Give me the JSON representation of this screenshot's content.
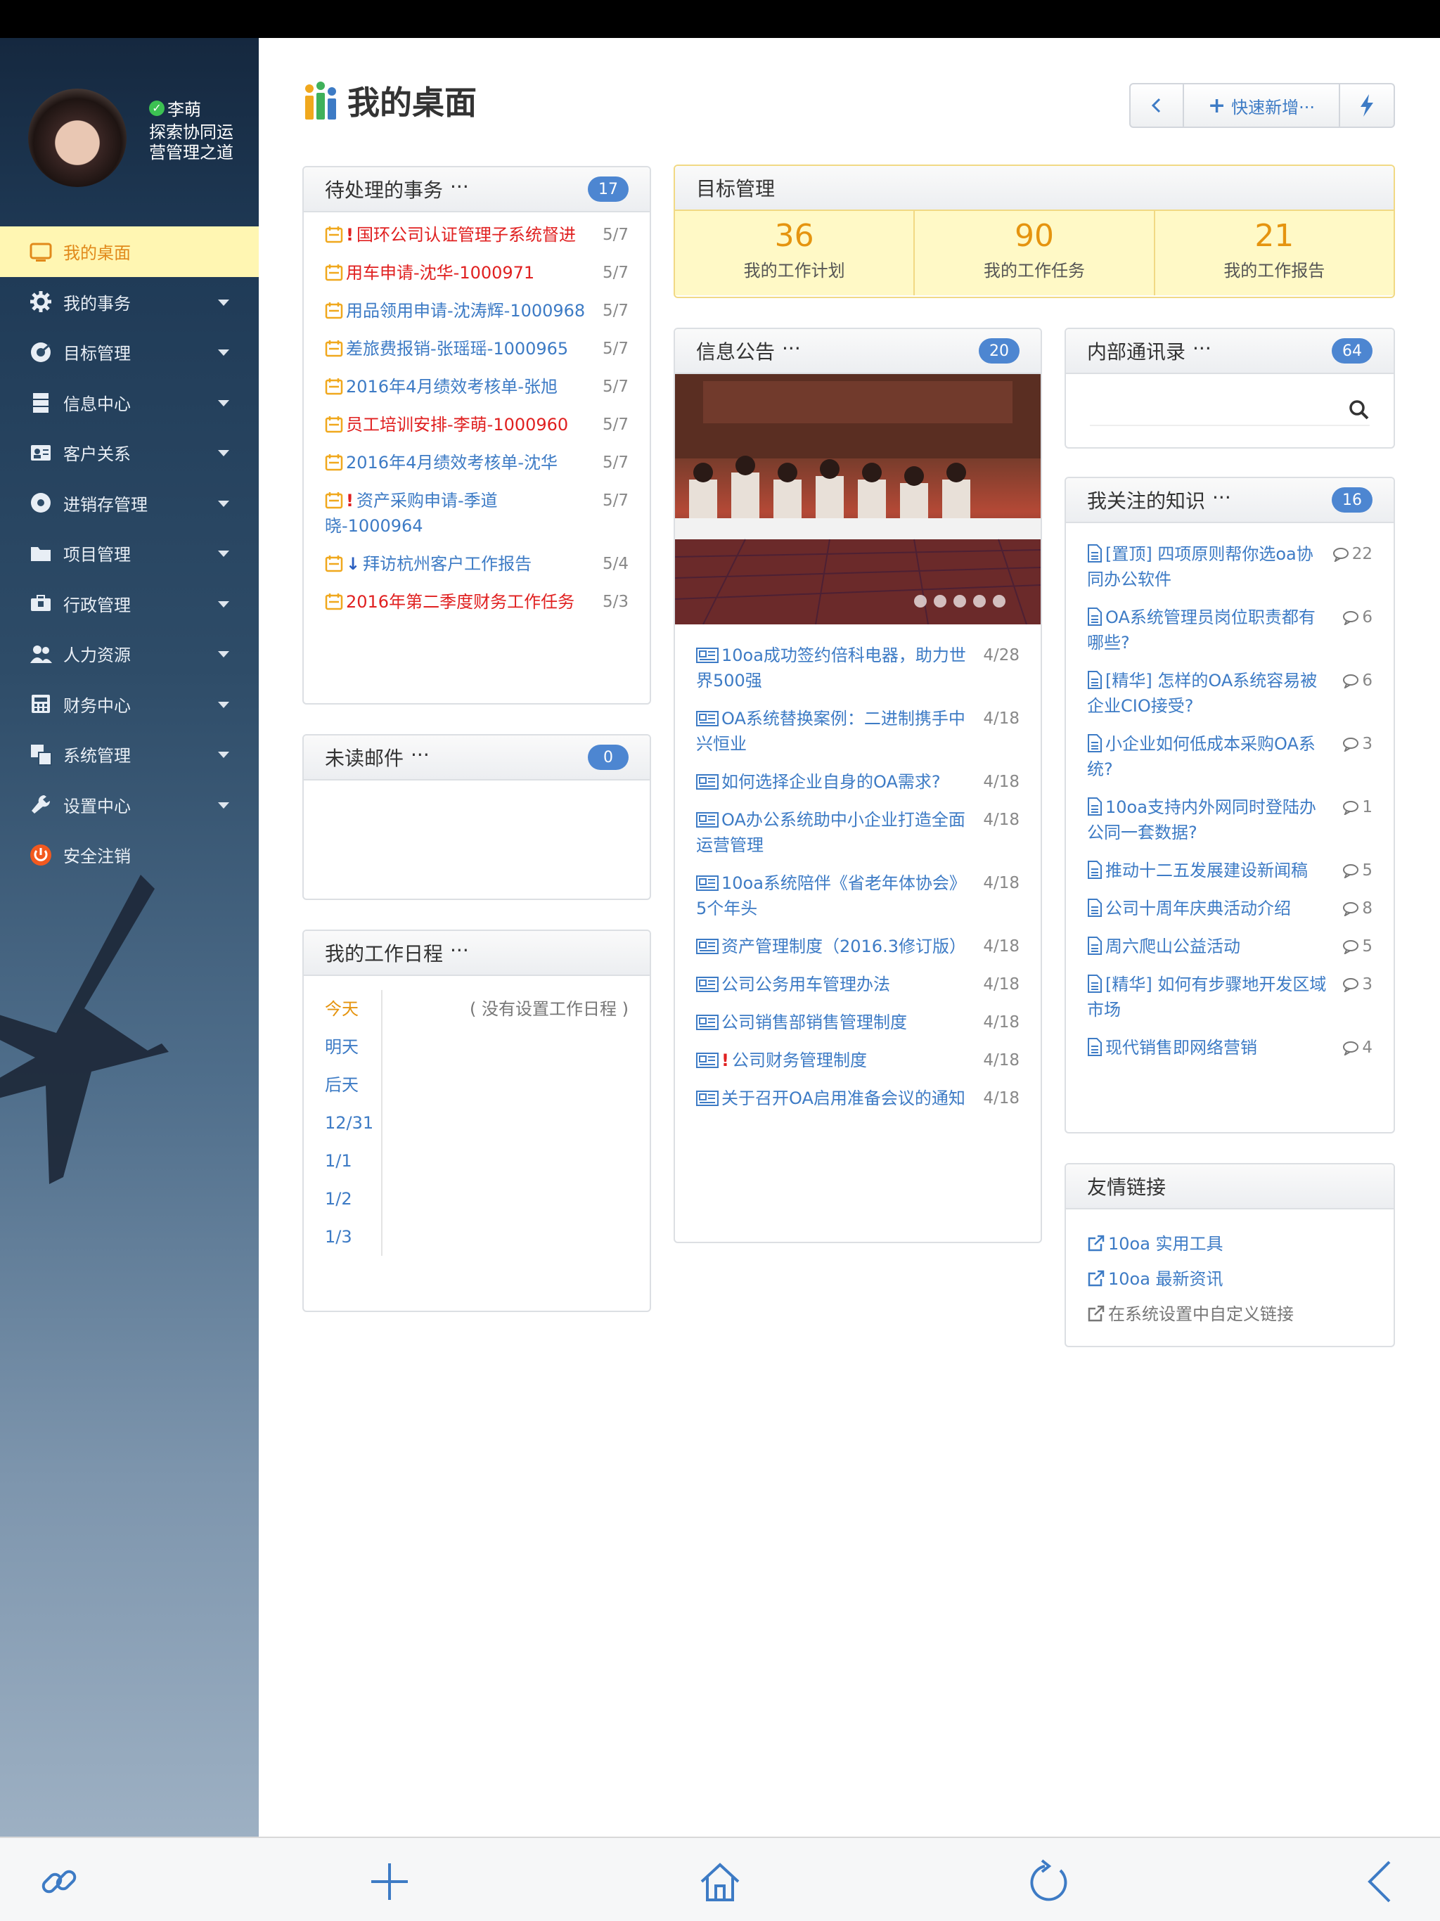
{
  "user": {
    "name": "李萌",
    "motto": "探索协同运营管理之道"
  },
  "nav": [
    {
      "label": "我的桌面",
      "icon": "monitor-icon",
      "active": true
    },
    {
      "label": "我的事务",
      "icon": "gear-icon"
    },
    {
      "label": "目标管理",
      "icon": "target-icon"
    },
    {
      "label": "信息中心",
      "icon": "stack-icon"
    },
    {
      "label": "客户关系",
      "icon": "contact-card-icon"
    },
    {
      "label": "进销存管理",
      "icon": "disc-icon"
    },
    {
      "label": "项目管理",
      "icon": "folder-icon"
    },
    {
      "label": "行政管理",
      "icon": "briefcase-icon"
    },
    {
      "label": "人力资源",
      "icon": "users-icon"
    },
    {
      "label": "财务中心",
      "icon": "calculator-icon"
    },
    {
      "label": "系统管理",
      "icon": "windows-icon"
    },
    {
      "label": "设置中心",
      "icon": "wrench-icon"
    },
    {
      "label": "安全注销",
      "icon": "power-icon"
    }
  ],
  "header": {
    "title": "我的桌面",
    "quick_add": "快速新增···"
  },
  "todo": {
    "title": "待处理的事务",
    "more": "···",
    "count": "17",
    "items": [
      {
        "text": "国环公司认证管理子系统督进",
        "date": "5/7",
        "color": "red",
        "flag": "urgent"
      },
      {
        "text": "用车申请-沈华-1000971",
        "date": "5/7",
        "color": "red",
        "flag": ""
      },
      {
        "text": "用品领用申请-沈涛辉-1000968",
        "date": "5/7",
        "color": "blue",
        "flag": ""
      },
      {
        "text": "差旅费报销-张瑶瑶-1000965",
        "date": "5/7",
        "color": "blue",
        "flag": ""
      },
      {
        "text": "2016年4月绩效考核单-张旭",
        "date": "5/7",
        "color": "blue",
        "flag": ""
      },
      {
        "text": "员工培训安排-李萌-1000960",
        "date": "5/7",
        "color": "red",
        "flag": ""
      },
      {
        "text": "2016年4月绩效考核单-沈华",
        "date": "5/7",
        "color": "blue",
        "flag": ""
      },
      {
        "text": "资产采购申请-季道晓-1000964",
        "date": "5/7",
        "color": "blue",
        "flag": "urgent"
      },
      {
        "text": "拜访杭州客户工作报告",
        "date": "5/4",
        "color": "blue",
        "flag": "low"
      },
      {
        "text": "2016年第二季度财务工作任务",
        "date": "5/3",
        "color": "red",
        "flag": ""
      }
    ]
  },
  "mail": {
    "title": "未读邮件",
    "more": "···",
    "count": "0"
  },
  "schedule": {
    "title": "我的工作日程",
    "more": "···",
    "days": [
      "今天",
      "明天",
      "后天",
      "12/31",
      "1/1",
      "1/2",
      "1/3"
    ],
    "empty": "( 没有设置工作日程 )"
  },
  "goals": {
    "title": "目标管理",
    "items": [
      {
        "value": "36",
        "label": "我的工作计划"
      },
      {
        "value": "90",
        "label": "我的工作任务"
      },
      {
        "value": "21",
        "label": "我的工作报告"
      }
    ]
  },
  "notices": {
    "title": "信息公告",
    "more": "···",
    "count": "20",
    "items": [
      {
        "text": "10oa成功签约倍科电器，助力世界500强",
        "date": "4/28",
        "flag": ""
      },
      {
        "text": "OA系统替换案例：二进制携手中兴恒业",
        "date": "4/18",
        "flag": ""
      },
      {
        "text": "如何选择企业自身的OA需求?",
        "date": "4/18",
        "flag": ""
      },
      {
        "text": "OA办公系统助中小企业打造全面运营管理",
        "date": "4/18",
        "flag": ""
      },
      {
        "text": "10oa系统陪伴《省老年体协会》5个年头",
        "date": "4/18",
        "flag": ""
      },
      {
        "text": "资产管理制度（2016.3修订版）",
        "date": "4/18",
        "flag": ""
      },
      {
        "text": "公司公务用车管理办法",
        "date": "4/18",
        "flag": ""
      },
      {
        "text": "公司销售部销售管理制度",
        "date": "4/18",
        "flag": ""
      },
      {
        "text": "公司财务管理制度",
        "date": "4/18",
        "flag": "urgent"
      },
      {
        "text": "关于召开OA启用准备会议的通知",
        "date": "4/18",
        "flag": ""
      }
    ]
  },
  "contacts": {
    "title": "内部通讯录",
    "more": "···",
    "count": "64"
  },
  "knowledge": {
    "title": "我关注的知识",
    "more": "···",
    "count": "16",
    "items": [
      {
        "text": "[置顶] 四项原则帮你选oa协同办公软件",
        "comments": "22"
      },
      {
        "text": "OA系统管理员岗位职责都有哪些?",
        "comments": "6"
      },
      {
        "text": "[精华] 怎样的OA系统容易被企业CIO接受?",
        "comments": "6"
      },
      {
        "text": "小企业如何低成本采购OA系统?",
        "comments": "3"
      },
      {
        "text": "10oa支持内外网同时登陆办公同一套数据?",
        "comments": "1"
      },
      {
        "text": "推动十二五发展建设新闻稿",
        "comments": "5"
      },
      {
        "text": "公司十周年庆典活动介绍",
        "comments": "8"
      },
      {
        "text": "周六爬山公益活动",
        "comments": "5"
      },
      {
        "text": "[精华] 如何有步骤地开发区域市场",
        "comments": "3"
      },
      {
        "text": "现代销售即网络营销",
        "comments": "4"
      }
    ]
  },
  "friendlinks": {
    "title": "友情链接",
    "items": [
      {
        "text": "10oa 实用工具",
        "muted": false
      },
      {
        "text": "10oa 最新资讯",
        "muted": false
      },
      {
        "text": "在系统设置中自定义链接",
        "muted": true
      }
    ]
  },
  "colors": {
    "accent": "#4d86d1",
    "link": "#3d7bc5",
    "warn": "#e5940f",
    "danger": "#e02020",
    "active_bg": "#fff6b2"
  }
}
